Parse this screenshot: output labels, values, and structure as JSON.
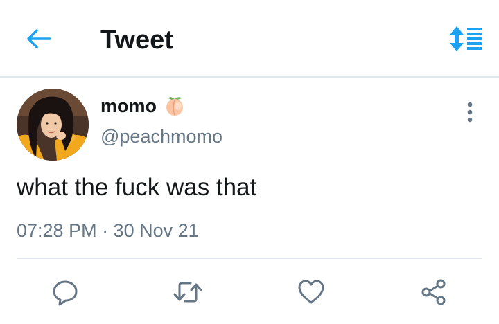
{
  "header": {
    "title": "Tweet",
    "back_icon": "arrow-left-icon",
    "sort_icon": "sort-list-icon"
  },
  "tweet": {
    "display_name": "momo",
    "name_emoji": "peach-emoji",
    "handle": "@peachmomo",
    "text": "what the fuck was that",
    "timestamp": "07:28 PM · 30 Nov 21"
  },
  "actions": [
    "reply-icon",
    "retweet-icon",
    "like-icon",
    "share-icon"
  ],
  "colors": {
    "accent": "#1da1f2",
    "text_primary": "#14171a",
    "text_secondary": "#657786",
    "divider": "#e1e8ed"
  }
}
